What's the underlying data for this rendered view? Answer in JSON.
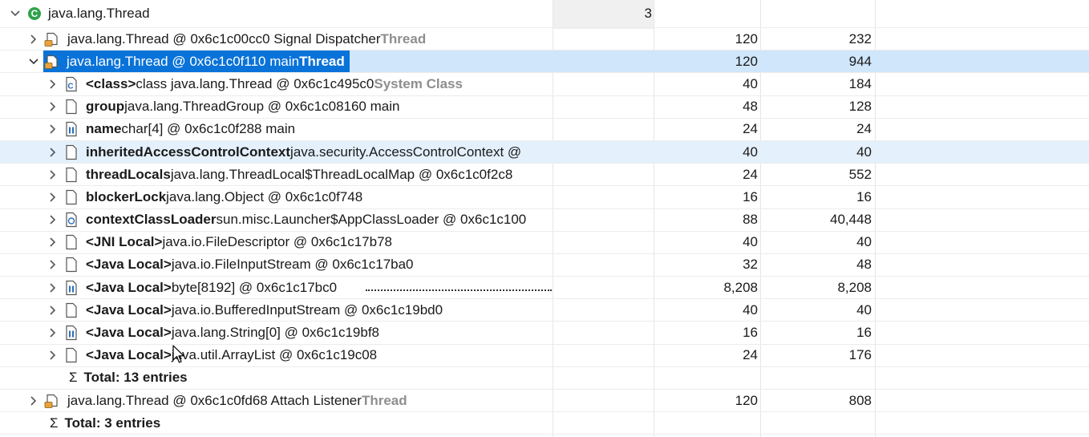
{
  "colors": {
    "selection": "#0a73d9",
    "selection_row": "#cfe6fb",
    "hover_row": "#e4f0fb",
    "class_icon": "#2fa24a"
  },
  "root": {
    "label": "java.lang.Thread",
    "col1": "3"
  },
  "rows": [
    {
      "prefix": "",
      "ref": "java.lang.Thread @ 0x6c1c00cc0  Signal Dispatcher ",
      "suffix": "Thread",
      "c2": "120",
      "c3": "232",
      "icon": "thread-icon"
    },
    {
      "prefix": "",
      "ref": "java.lang.Thread @ 0x6c1c0f110  main ",
      "suffix": "Thread",
      "c2": "120",
      "c3": "944",
      "icon": "thread-icon"
    },
    {
      "prefix": "<class>",
      "ref": " class java.lang.Thread @ 0x6c1c495c0 ",
      "suffix": "System Class",
      "c2": "40",
      "c3": "184",
      "icon": "class-object-icon"
    },
    {
      "prefix": "group",
      "ref": " java.lang.ThreadGroup @ 0x6c1c08160  main",
      "suffix": "",
      "c2": "48",
      "c3": "128",
      "icon": "object-icon"
    },
    {
      "prefix": "name",
      "ref": " char[4] @ 0x6c1c0f288  main",
      "suffix": "",
      "c2": "24",
      "c3": "24",
      "icon": "array-icon"
    },
    {
      "prefix": "inheritedAccessControlContext",
      "ref": " java.security.AccessControlContext @",
      "suffix": "",
      "c2": "40",
      "c3": "40",
      "icon": "object-icon"
    },
    {
      "prefix": "threadLocals",
      "ref": " java.lang.ThreadLocal$ThreadLocalMap @ 0x6c1c0f2c8",
      "suffix": "",
      "c2": "24",
      "c3": "552",
      "icon": "object-icon"
    },
    {
      "prefix": "blockerLock",
      "ref": " java.lang.Object @ 0x6c1c0f748",
      "suffix": "",
      "c2": "16",
      "c3": "16",
      "icon": "object-icon"
    },
    {
      "prefix": "contextClassLoader",
      "ref": " sun.misc.Launcher$AppClassLoader @ 0x6c1c100",
      "suffix": "",
      "c2": "88",
      "c3": "40,448",
      "icon": "classloader-icon"
    },
    {
      "prefix": "<JNI Local>",
      "ref": " java.io.FileDescriptor @ 0x6c1c17b78",
      "suffix": "",
      "c2": "40",
      "c3": "40",
      "icon": "object-icon"
    },
    {
      "prefix": "<Java Local>",
      "ref": " java.io.FileInputStream @ 0x6c1c17ba0",
      "suffix": "",
      "c2": "32",
      "c3": "48",
      "icon": "object-icon"
    },
    {
      "prefix": "<Java Local>",
      "ref": " byte[8192] @ 0x6c1c17bc0",
      "suffix": "",
      "c2": "8,208",
      "c3": "8,208",
      "icon": "array-icon"
    },
    {
      "prefix": "<Java Local>",
      "ref": " java.io.BufferedInputStream @ 0x6c1c19bd0",
      "suffix": "",
      "c2": "40",
      "c3": "40",
      "icon": "object-icon"
    },
    {
      "prefix": "<Java Local>",
      "ref": " java.lang.String[0] @ 0x6c1c19bf8",
      "suffix": "",
      "c2": "16",
      "c3": "16",
      "icon": "array-icon"
    },
    {
      "prefix": "<Java Local>",
      "ref": " java.util.ArrayList @ 0x6c1c19c08",
      "suffix": "",
      "c2": "24",
      "c3": "176",
      "icon": "object-icon"
    }
  ],
  "total_children": "Total: 13 entries",
  "row_after": {
    "ref": "java.lang.Thread @ 0x6c1c0fd68  Attach Listener ",
    "suffix": "Thread",
    "c2": "120",
    "c3": "808"
  },
  "total_root": "Total: 3 entries",
  "sigma": "Σ"
}
